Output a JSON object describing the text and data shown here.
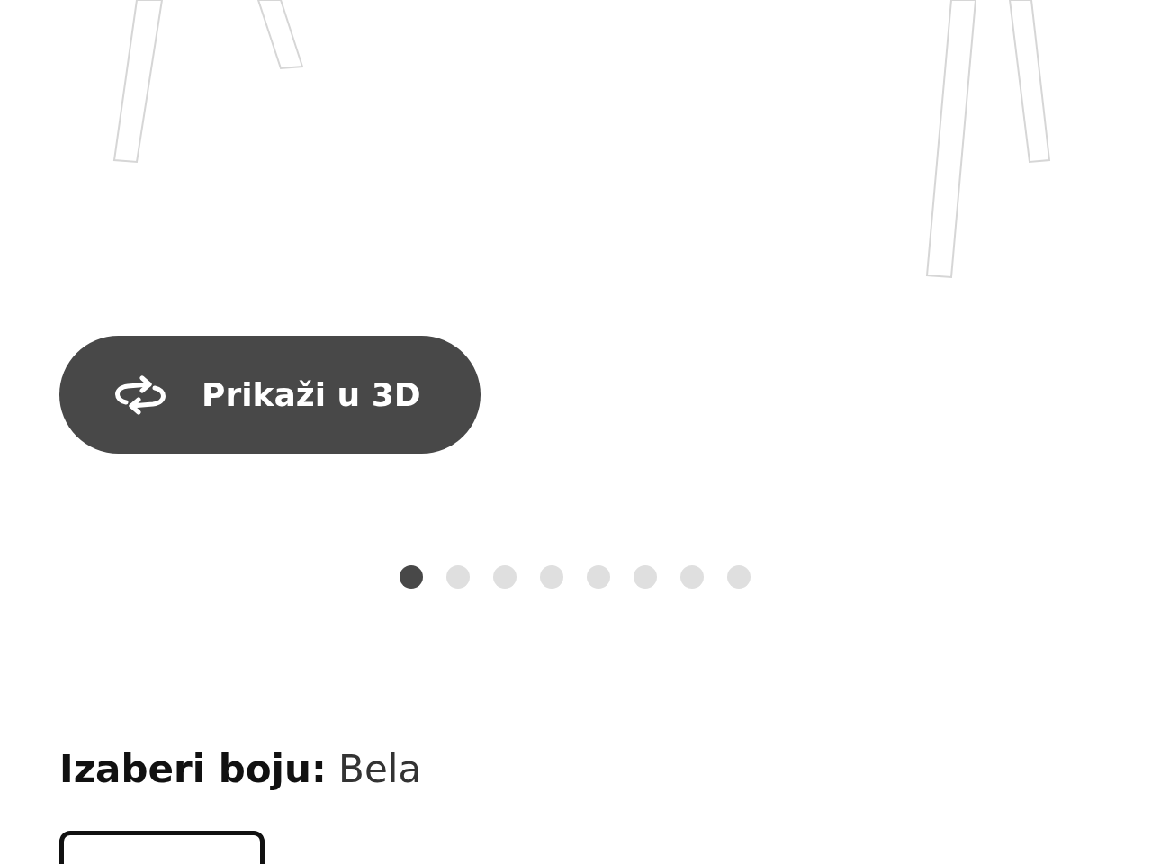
{
  "view_3d_button": {
    "label": "Prikaži u 3D"
  },
  "carousel_dots": [
    {
      "selected": true
    },
    {
      "selected": false
    },
    {
      "selected": false
    },
    {
      "selected": false
    },
    {
      "selected": false
    },
    {
      "selected": false
    },
    {
      "selected": false
    },
    {
      "selected": false
    }
  ],
  "color_picker": {
    "label": "**Izaberi boju:** Bela",
    "swatches": [
      {
        "selected": true,
        "color": "#ffffff"
      }
    ]
  }
}
